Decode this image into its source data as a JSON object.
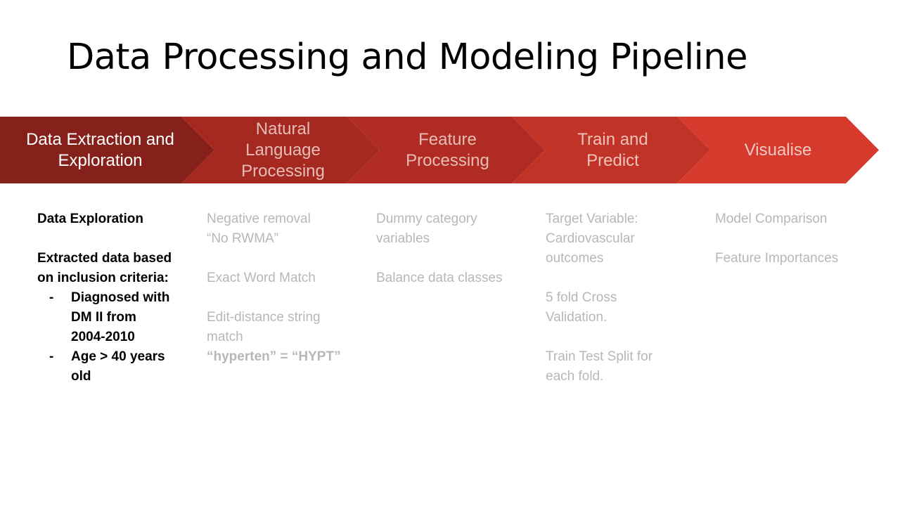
{
  "slide": {
    "title": "Data Processing and Modeling Pipeline"
  },
  "pipeline": {
    "steps": [
      {
        "label": "Data Extraction and\nExploration",
        "fill": "#85201a",
        "text_color": "#ffffff"
      },
      {
        "label": "Natural\nLanguage\nProcessing",
        "fill": "#a52821",
        "text_color": "#e6bdb6"
      },
      {
        "label": "Feature\nProcessing",
        "fill": "#b02b23",
        "text_color": "#e6bdb6"
      },
      {
        "label": "Train and\nPredict",
        "fill": "#c23327",
        "text_color": "#eec2bb"
      },
      {
        "label": "Visualise",
        "fill": "#d63a2c",
        "text_color": "#f2c9c2"
      }
    ]
  },
  "details": {
    "col1": {
      "heading": "Data Exploration",
      "subheading": "Extracted data based\non inclusion criteria:",
      "bullets": [
        "Diagnosed with\nDM II from\n2004-2010",
        "Age > 40 years\nold"
      ],
      "bullet_marker": "-"
    },
    "col2": {
      "item1": "Negative removal\n“No RWMA”",
      "item2": "Exact Word Match",
      "item3": "Edit-distance string\nmatch",
      "item3_example": "“hyperten” = “HYPT”"
    },
    "col3": {
      "item1": "Dummy category\nvariables",
      "item2": "Balance data classes"
    },
    "col4": {
      "item1": "Target Variable:\nCardiovascular\noutcomes",
      "item2": "5 fold Cross\nValidation.",
      "item3": "Train Test Split for\neach fold."
    },
    "col5": {
      "item1": "Model Comparison",
      "item2": "Feature Importances"
    }
  },
  "colors": {
    "active_text": "#000000",
    "inactive_text": "#b7b7b7"
  }
}
